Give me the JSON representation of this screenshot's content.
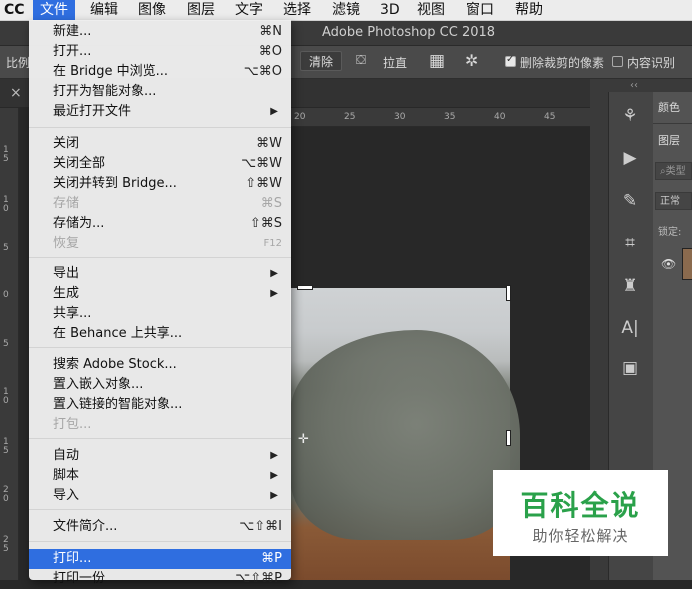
{
  "menubar": {
    "items": [
      "CC",
      "文件",
      "编辑",
      "图像",
      "图层",
      "文字",
      "选择",
      "滤镜",
      "3D",
      "视图",
      "窗口",
      "帮助"
    ],
    "active_index": 1
  },
  "app": {
    "title": "Adobe Photoshop CC 2018"
  },
  "options_bar": {
    "ratio_label": "比例",
    "clear_button": "清除",
    "straighten_label": "拉直",
    "delete_cropped_label": "删除裁剪的像素",
    "delete_cropped_checked": true,
    "content_aware_label": "内容识别",
    "content_aware_checked": false
  },
  "doc_tab": {
    "close": "×"
  },
  "ruler_top_ticks": [
    "20",
    "25",
    "30",
    "35",
    "40",
    "45"
  ],
  "ruler_left_ticks": [
    "1\n5",
    "1\n0",
    "5",
    "0",
    "5",
    "1\n0",
    "1\n5",
    "2\n0",
    "2\n5"
  ],
  "panels": {
    "color_tab": "颜色",
    "layers_tab": "图层",
    "search_placeholder": "类型",
    "blend_mode": "正常",
    "lock_label": "锁定:"
  },
  "file_menu": {
    "items": [
      {
        "label": "新建...",
        "shortcut": "⌘N"
      },
      {
        "label": "打开...",
        "shortcut": "⌘O"
      },
      {
        "label": "在 Bridge 中浏览...",
        "shortcut": "⌥⌘O"
      },
      {
        "label": "打开为智能对象...",
        "shortcut": ""
      },
      {
        "label": "最近打开文件",
        "shortcut": "",
        "submenu": true
      },
      {
        "label": "关闭",
        "shortcut": "⌘W"
      },
      {
        "label": "关闭全部",
        "shortcut": "⌥⌘W"
      },
      {
        "label": "关闭并转到 Bridge...",
        "shortcut": "⇧⌘W"
      },
      {
        "label": "存储",
        "shortcut": "⌘S",
        "disabled": true
      },
      {
        "label": "存储为...",
        "shortcut": "⇧⌘S"
      },
      {
        "label": "恢复",
        "shortcut": "F12",
        "disabled": true
      },
      {
        "label": "导出",
        "shortcut": "",
        "submenu": true
      },
      {
        "label": "生成",
        "shortcut": "",
        "submenu": true
      },
      {
        "label": "共享...",
        "shortcut": ""
      },
      {
        "label": "在 Behance 上共享...",
        "shortcut": ""
      },
      {
        "label": "搜索 Adobe Stock...",
        "shortcut": ""
      },
      {
        "label": "置入嵌入对象...",
        "shortcut": ""
      },
      {
        "label": "置入链接的智能对象...",
        "shortcut": ""
      },
      {
        "label": "打包...",
        "shortcut": "",
        "disabled": true
      },
      {
        "label": "自动",
        "shortcut": "",
        "submenu": true
      },
      {
        "label": "脚本",
        "shortcut": "",
        "submenu": true
      },
      {
        "label": "导入",
        "shortcut": "",
        "submenu": true
      },
      {
        "label": "文件简介...",
        "shortcut": "⌥⇧⌘I"
      },
      {
        "label": "打印...",
        "shortcut": "⌘P",
        "highlighted": true
      },
      {
        "label": "打印一份",
        "shortcut": "⌥⇧⌘P"
      }
    ]
  },
  "watermark": {
    "main": "百科全说",
    "sub": "助你轻松解决"
  }
}
